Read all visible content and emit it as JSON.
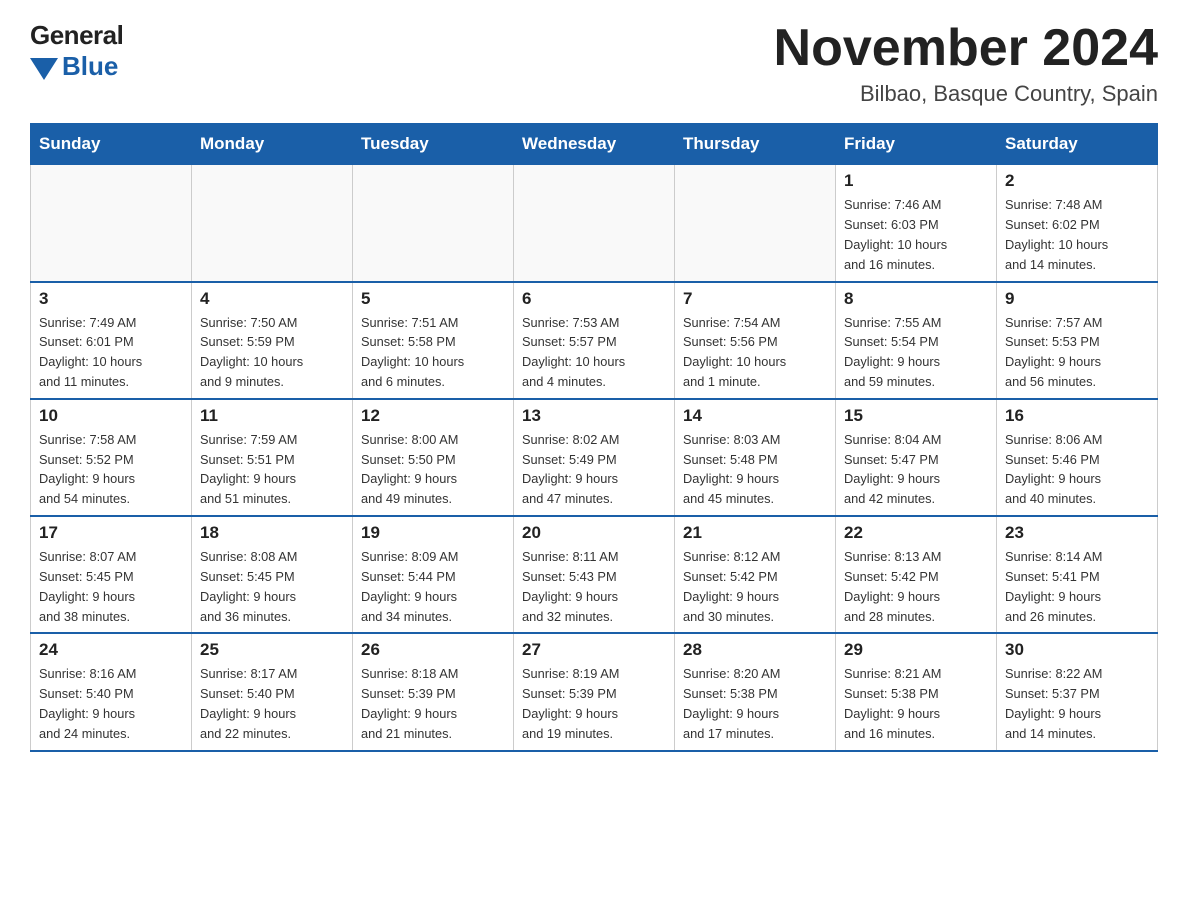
{
  "logo": {
    "general": "General",
    "blue": "Blue"
  },
  "title": "November 2024",
  "subtitle": "Bilbao, Basque Country, Spain",
  "days_of_week": [
    "Sunday",
    "Monday",
    "Tuesday",
    "Wednesday",
    "Thursday",
    "Friday",
    "Saturday"
  ],
  "weeks": [
    [
      {
        "day": "",
        "info": ""
      },
      {
        "day": "",
        "info": ""
      },
      {
        "day": "",
        "info": ""
      },
      {
        "day": "",
        "info": ""
      },
      {
        "day": "",
        "info": ""
      },
      {
        "day": "1",
        "info": "Sunrise: 7:46 AM\nSunset: 6:03 PM\nDaylight: 10 hours\nand 16 minutes."
      },
      {
        "day": "2",
        "info": "Sunrise: 7:48 AM\nSunset: 6:02 PM\nDaylight: 10 hours\nand 14 minutes."
      }
    ],
    [
      {
        "day": "3",
        "info": "Sunrise: 7:49 AM\nSunset: 6:01 PM\nDaylight: 10 hours\nand 11 minutes."
      },
      {
        "day": "4",
        "info": "Sunrise: 7:50 AM\nSunset: 5:59 PM\nDaylight: 10 hours\nand 9 minutes."
      },
      {
        "day": "5",
        "info": "Sunrise: 7:51 AM\nSunset: 5:58 PM\nDaylight: 10 hours\nand 6 minutes."
      },
      {
        "day": "6",
        "info": "Sunrise: 7:53 AM\nSunset: 5:57 PM\nDaylight: 10 hours\nand 4 minutes."
      },
      {
        "day": "7",
        "info": "Sunrise: 7:54 AM\nSunset: 5:56 PM\nDaylight: 10 hours\nand 1 minute."
      },
      {
        "day": "8",
        "info": "Sunrise: 7:55 AM\nSunset: 5:54 PM\nDaylight: 9 hours\nand 59 minutes."
      },
      {
        "day": "9",
        "info": "Sunrise: 7:57 AM\nSunset: 5:53 PM\nDaylight: 9 hours\nand 56 minutes."
      }
    ],
    [
      {
        "day": "10",
        "info": "Sunrise: 7:58 AM\nSunset: 5:52 PM\nDaylight: 9 hours\nand 54 minutes."
      },
      {
        "day": "11",
        "info": "Sunrise: 7:59 AM\nSunset: 5:51 PM\nDaylight: 9 hours\nand 51 minutes."
      },
      {
        "day": "12",
        "info": "Sunrise: 8:00 AM\nSunset: 5:50 PM\nDaylight: 9 hours\nand 49 minutes."
      },
      {
        "day": "13",
        "info": "Sunrise: 8:02 AM\nSunset: 5:49 PM\nDaylight: 9 hours\nand 47 minutes."
      },
      {
        "day": "14",
        "info": "Sunrise: 8:03 AM\nSunset: 5:48 PM\nDaylight: 9 hours\nand 45 minutes."
      },
      {
        "day": "15",
        "info": "Sunrise: 8:04 AM\nSunset: 5:47 PM\nDaylight: 9 hours\nand 42 minutes."
      },
      {
        "day": "16",
        "info": "Sunrise: 8:06 AM\nSunset: 5:46 PM\nDaylight: 9 hours\nand 40 minutes."
      }
    ],
    [
      {
        "day": "17",
        "info": "Sunrise: 8:07 AM\nSunset: 5:45 PM\nDaylight: 9 hours\nand 38 minutes."
      },
      {
        "day": "18",
        "info": "Sunrise: 8:08 AM\nSunset: 5:45 PM\nDaylight: 9 hours\nand 36 minutes."
      },
      {
        "day": "19",
        "info": "Sunrise: 8:09 AM\nSunset: 5:44 PM\nDaylight: 9 hours\nand 34 minutes."
      },
      {
        "day": "20",
        "info": "Sunrise: 8:11 AM\nSunset: 5:43 PM\nDaylight: 9 hours\nand 32 minutes."
      },
      {
        "day": "21",
        "info": "Sunrise: 8:12 AM\nSunset: 5:42 PM\nDaylight: 9 hours\nand 30 minutes."
      },
      {
        "day": "22",
        "info": "Sunrise: 8:13 AM\nSunset: 5:42 PM\nDaylight: 9 hours\nand 28 minutes."
      },
      {
        "day": "23",
        "info": "Sunrise: 8:14 AM\nSunset: 5:41 PM\nDaylight: 9 hours\nand 26 minutes."
      }
    ],
    [
      {
        "day": "24",
        "info": "Sunrise: 8:16 AM\nSunset: 5:40 PM\nDaylight: 9 hours\nand 24 minutes."
      },
      {
        "day": "25",
        "info": "Sunrise: 8:17 AM\nSunset: 5:40 PM\nDaylight: 9 hours\nand 22 minutes."
      },
      {
        "day": "26",
        "info": "Sunrise: 8:18 AM\nSunset: 5:39 PM\nDaylight: 9 hours\nand 21 minutes."
      },
      {
        "day": "27",
        "info": "Sunrise: 8:19 AM\nSunset: 5:39 PM\nDaylight: 9 hours\nand 19 minutes."
      },
      {
        "day": "28",
        "info": "Sunrise: 8:20 AM\nSunset: 5:38 PM\nDaylight: 9 hours\nand 17 minutes."
      },
      {
        "day": "29",
        "info": "Sunrise: 8:21 AM\nSunset: 5:38 PM\nDaylight: 9 hours\nand 16 minutes."
      },
      {
        "day": "30",
        "info": "Sunrise: 8:22 AM\nSunset: 5:37 PM\nDaylight: 9 hours\nand 14 minutes."
      }
    ]
  ]
}
